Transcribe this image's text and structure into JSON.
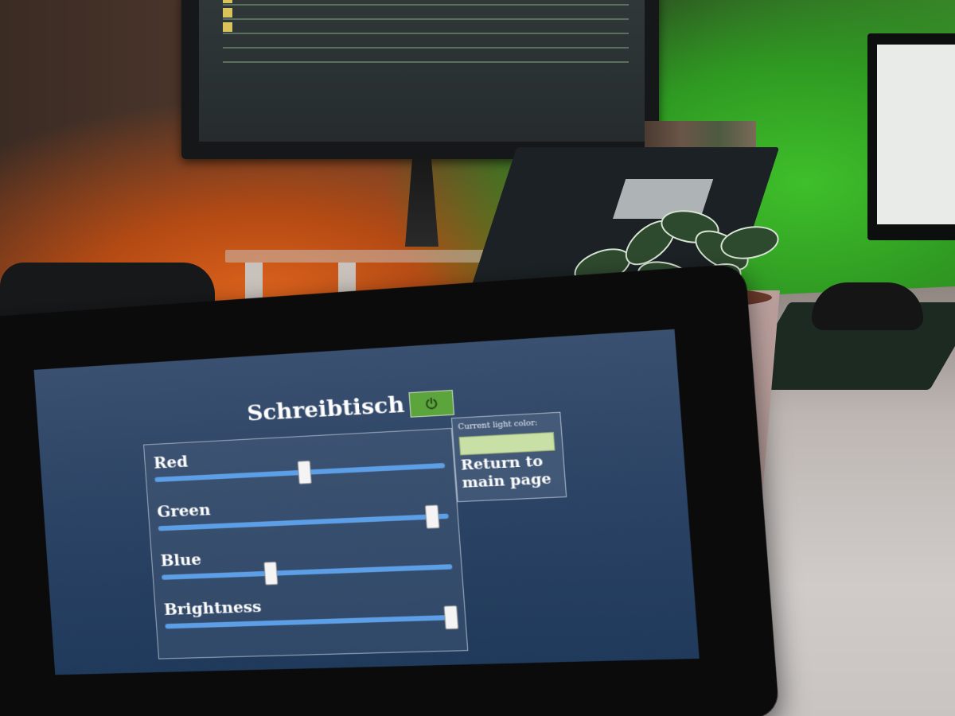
{
  "panel": {
    "title": "Schreibtisch",
    "power_state": "on",
    "colors": {
      "accent_power": "#5ca43c",
      "track": "#5d9fe6",
      "current_light": "#c8dfa6"
    }
  },
  "sliders": [
    {
      "label": "Red",
      "value": 0.52
    },
    {
      "label": "Green",
      "value": 0.94
    },
    {
      "label": "Blue",
      "value": 0.38
    },
    {
      "label": "Brightness",
      "value": 1.0
    }
  ],
  "info": {
    "current_label": "Current light color:",
    "return_label": "Return to main page"
  }
}
